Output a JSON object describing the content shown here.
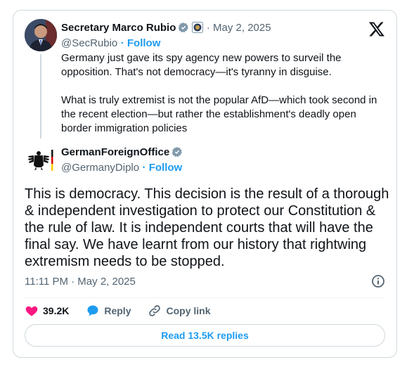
{
  "quoted": {
    "name": "Secretary Marco Rubio",
    "date": "· May 2, 2025",
    "handle": "@SecRubio",
    "follow": "· Follow",
    "text_p1": "Germany just gave its spy agency new powers to surveil the opposition.  That's not democracy—it's tyranny in disguise.",
    "text_p2": "What is truly extremist is not the popular AfD—which took second in the recent election—but rather the establishment's deadly open border immigration policies"
  },
  "main": {
    "name": "GermanForeignOffice",
    "handle": "@GermanyDiplo",
    "follow": "· Follow",
    "text": "This is democracy. This decision is the result of a thorough & independent investigation to protect our Constitution & the rule of law. It is independent courts that will have the final say. We have learnt from our history that rightwing extremism needs to be stopped.",
    "timestamp": "11:11 PM · May 2, 2025"
  },
  "actions": {
    "likes": "39.2K",
    "reply": "Reply",
    "copy_link": "Copy link"
  },
  "replies_button": "Read 13.5K replies",
  "colors": {
    "accent": "#1d9bf0",
    "like": "#f91880",
    "text": "#0f1419",
    "muted": "#536471",
    "border": "#cfd9de"
  },
  "icons": [
    "x-logo-icon",
    "verified-badge-icon",
    "government-seal-icon",
    "heart-icon",
    "reply-bubble-icon",
    "link-icon",
    "info-icon"
  ]
}
